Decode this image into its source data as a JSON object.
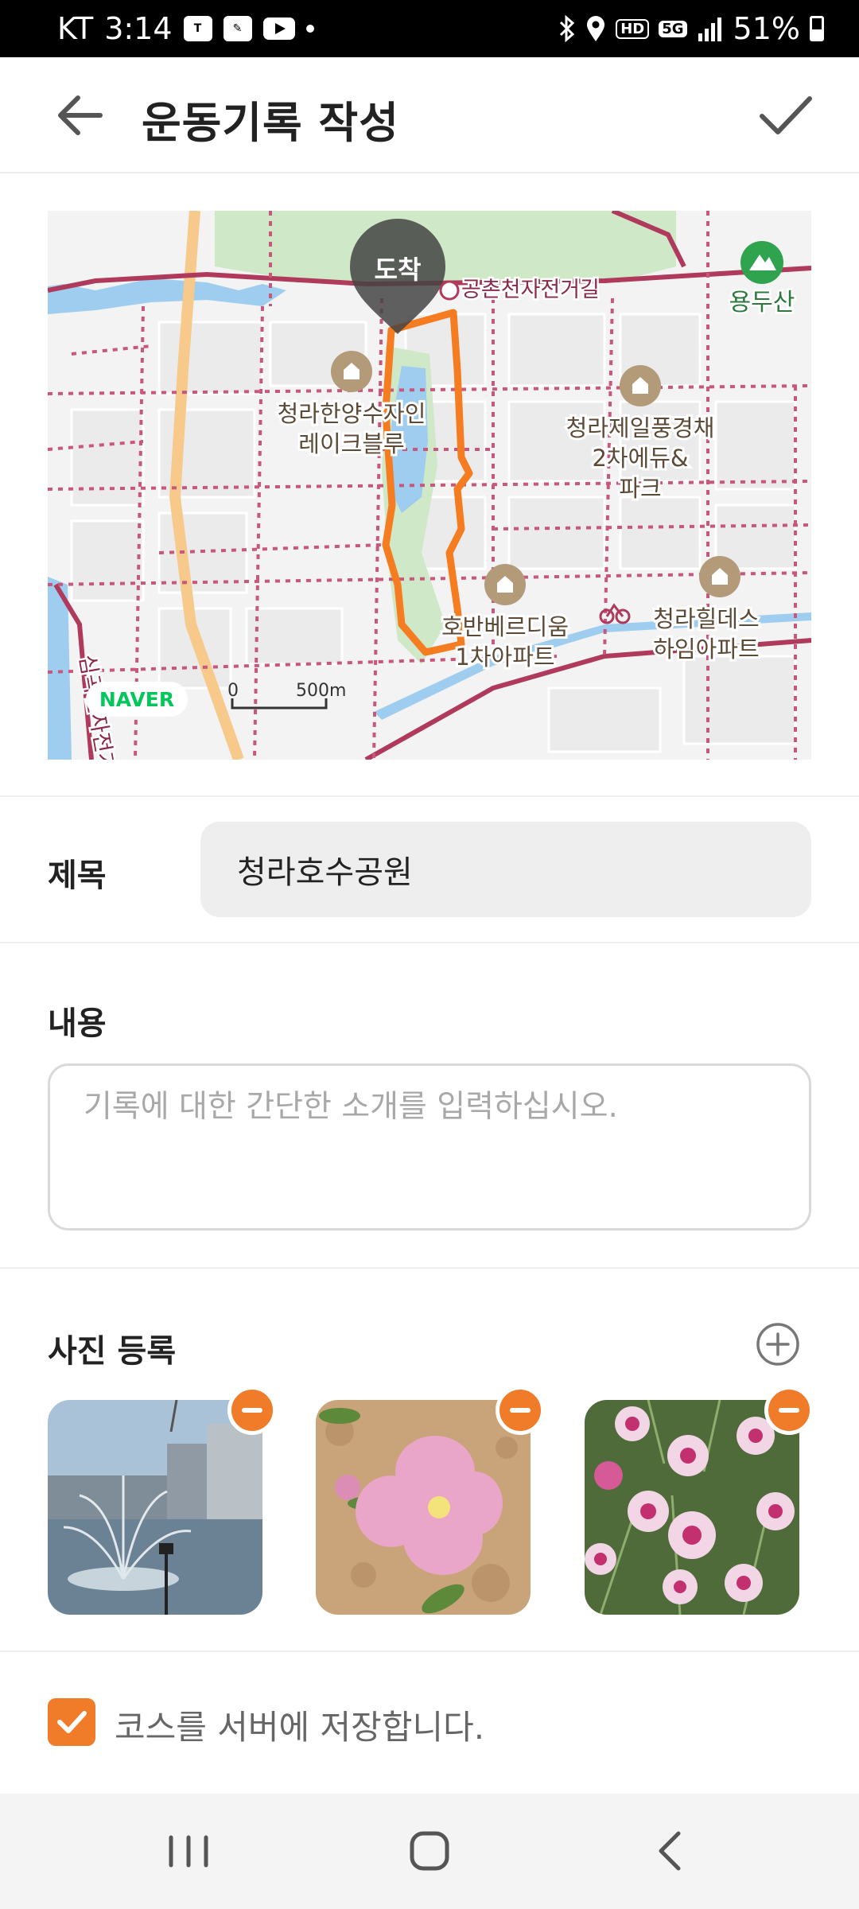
{
  "status_bar": {
    "carrier": "KT",
    "time": "3:14",
    "network_badge": "HD",
    "network_type": "5G",
    "battery": "51%",
    "icons": [
      "tmoney-icon",
      "running-app-icon",
      "youtube-icon",
      "dot-icon",
      "bluetooth-icon",
      "location-icon",
      "hd-voice-icon",
      "5g-icon",
      "signal-icon",
      "battery-icon"
    ]
  },
  "header": {
    "title": "운동기록 작성",
    "back_icon": "back-arrow-icon",
    "confirm_icon": "check-icon"
  },
  "map": {
    "arrival_marker": "도착",
    "labels": {
      "bike_road": "공촌천자전거길",
      "mountain": "용두산",
      "apt1_line1": "청라한양수자인",
      "apt1_line2": "레이크블루",
      "apt2_line1": "청라제일풍경채",
      "apt2_line2": "2차에듀&",
      "apt2_line3": "파크",
      "apt3_line1": "호반베르디움",
      "apt3_line2": "1차아파트",
      "apt4_line1": "청라힐데스",
      "apt4_line2": "하임아파트",
      "side_road": "심곡천자전거",
      "scale_zero": "0",
      "scale_distance": "500m",
      "provider": "NAVER"
    },
    "colors": {
      "route": "#f57c20",
      "bike_road": "#b03a5b",
      "park": "#cfe8c8",
      "water": "#9fcdf0",
      "arterial_road": "#f7c98a",
      "brand": "#03c75a"
    }
  },
  "form": {
    "title_label": "제목",
    "title_value": "청라호수공원",
    "content_label": "내용",
    "content_placeholder": "기록에 대한 간단한 소개를 입력하십시오.",
    "photo_label": "사진 등록",
    "photos": [
      {
        "subject": "fountain-photo"
      },
      {
        "subject": "pink-primrose-photo"
      },
      {
        "subject": "pink-dianthus-photo"
      }
    ],
    "save_course_checked": true,
    "save_course_label": "코스를 서버에 저장합니다."
  },
  "nav": {
    "recent": "recent-apps-icon",
    "home": "home-icon",
    "back": "back-icon"
  },
  "theme": {
    "accent": "#f07c2a"
  }
}
